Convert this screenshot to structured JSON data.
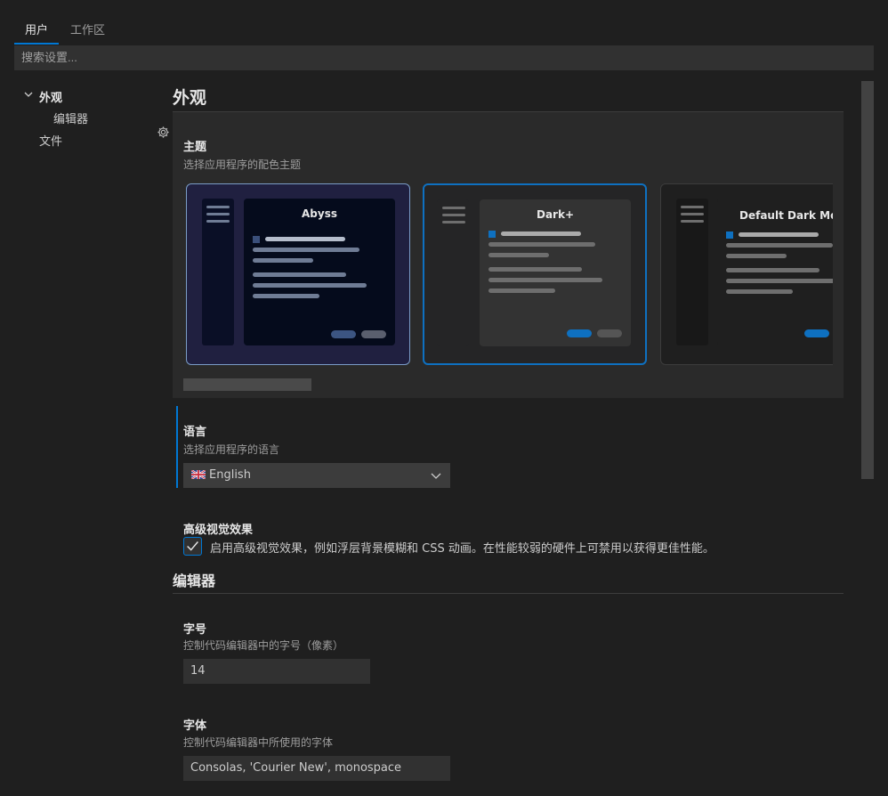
{
  "tabs": [
    {
      "label": "用户",
      "active": true
    },
    {
      "label": "工作区",
      "active": false
    }
  ],
  "search": {
    "placeholder": "搜索设置..."
  },
  "toc": {
    "items": [
      {
        "label": "外观",
        "expanded": true,
        "bold": true
      },
      {
        "label": "编辑器",
        "indent": true
      },
      {
        "label": "文件"
      }
    ],
    "gear_icon": "gear-icon"
  },
  "appearance": {
    "title": "外观",
    "theme": {
      "title": "主题",
      "desc": "选择应用程序的配色主题",
      "cards": [
        {
          "name": "Abyss",
          "selected": false
        },
        {
          "name": "Dark+",
          "selected": true
        },
        {
          "name": "Default Dark Modern",
          "selected": false
        }
      ]
    },
    "language": {
      "title": "语言",
      "desc": "选择应用程序的语言",
      "value": "English",
      "flag": "🇬🇧"
    },
    "effects": {
      "title": "高级视觉效果",
      "checkbox_label": "启用高级视觉效果，例如浮层背景模糊和 CSS 动画。在性能较弱的硬件上可禁用以获得更佳性能。",
      "checked": true
    }
  },
  "editor": {
    "title": "编辑器",
    "font_size": {
      "title": "字号",
      "desc": "控制代码编辑器中的字号（像素）",
      "value": "14"
    },
    "font_family": {
      "title": "字体",
      "desc": "控制代码编辑器中所使用的字体",
      "value": "Consolas, 'Courier New', monospace"
    }
  },
  "colors": {
    "accent": "#0078d4",
    "background": "#1f1f1f"
  }
}
